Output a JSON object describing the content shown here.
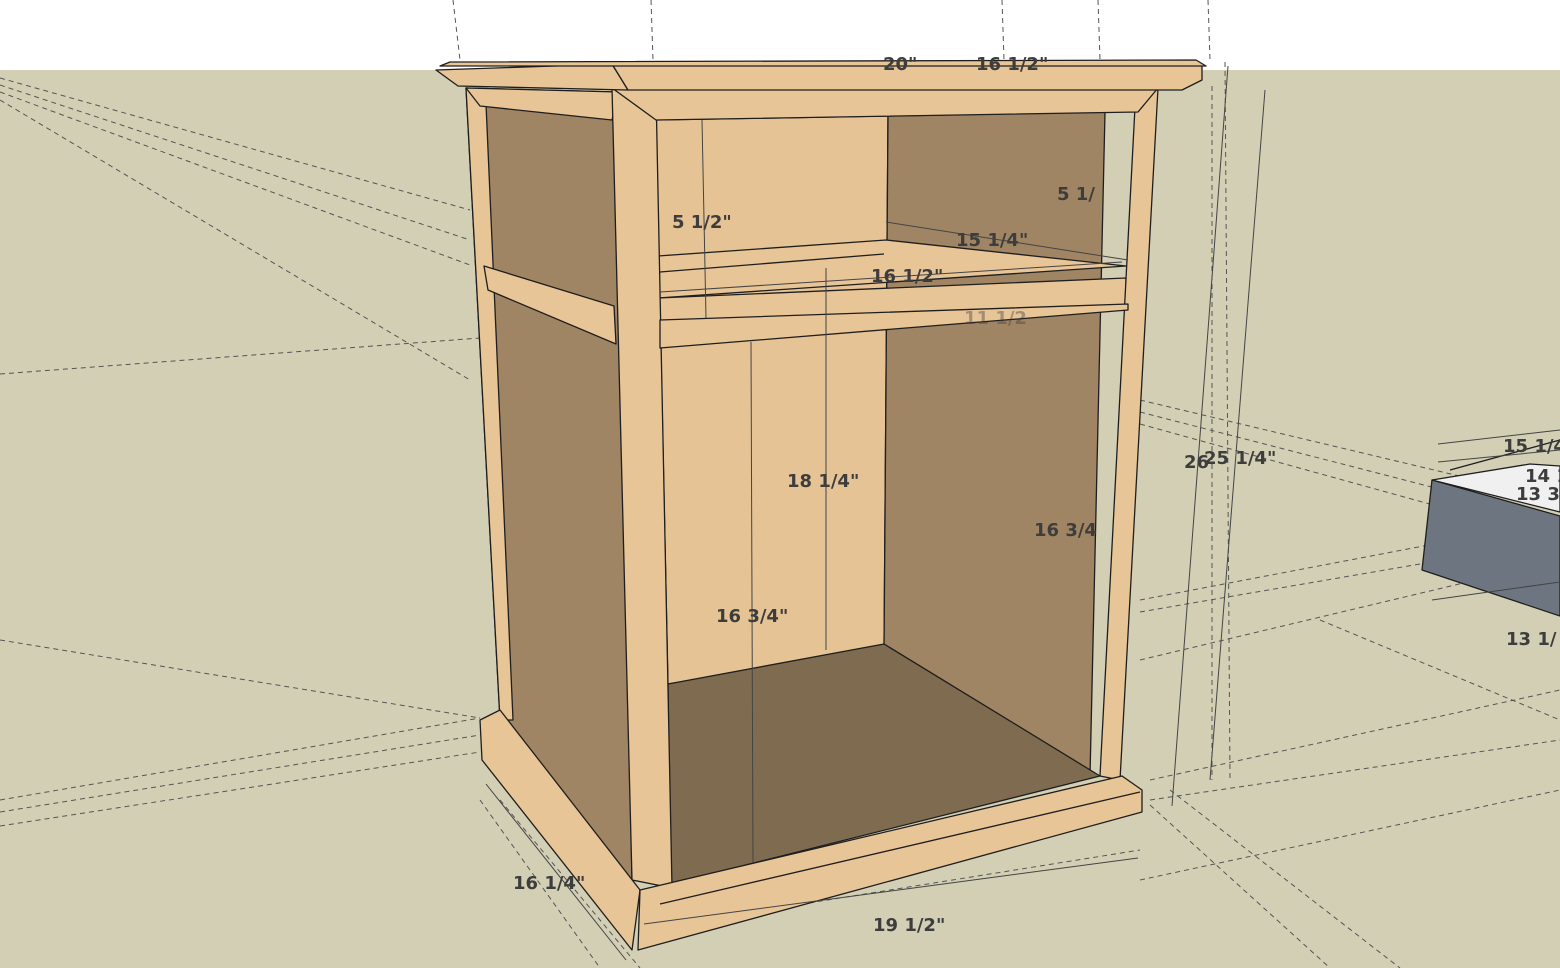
{
  "colors": {
    "sky": "#ffffff",
    "ground": "#d2cfb5",
    "wood_light": "#e8c597",
    "wood_back": "#e6c395",
    "side_panel": "#9f8564",
    "floor_panel": "#7f6c50",
    "edge": "#1e1e1e",
    "drawer": "#6d7680",
    "dimension_text": "#3d3d3d"
  },
  "dimensions": {
    "top_width": "20\"",
    "top_depth": "16 1/2\"",
    "upper_opening_height": "5 1/2\"",
    "upper_opening_height_right": "5 1/",
    "shelf_depth": "15 1/4\"",
    "shelf_width": "16 1/2\"",
    "shelf_partial": "11 1/2",
    "back_height": "18 1/4\"",
    "lower_opening_height": "16 3/4\"",
    "lower_opening_height_right": "16 3/4",
    "overall_height": "26",
    "case_height": "25 1/4\"",
    "base_depth": "16 1/4\"",
    "base_width": "19 1/2\""
  },
  "drawer_dimensions": {
    "outer_depth": "15 1/4",
    "inner_depth": "14 1",
    "inner_depth_2": "13 3/",
    "front_width": "13 1/"
  }
}
